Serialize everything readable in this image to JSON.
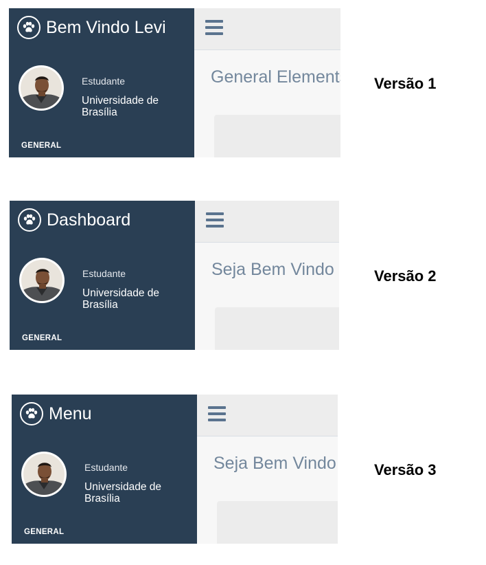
{
  "versions": [
    {
      "brand_title": "Bem Vindo Levi",
      "profile_role": "Estudante",
      "profile_institution": "Universidade de Brasília",
      "sidebar_section": "GENERAL",
      "page_title": "General Elements",
      "label": "Versão 1"
    },
    {
      "brand_title": "Dashboard",
      "profile_role": "Estudante",
      "profile_institution": "Universidade de Brasília",
      "sidebar_section": "GENERAL",
      "page_title": "Seja Bem Vindo",
      "label": "Versão 2"
    },
    {
      "brand_title": "Menu",
      "profile_role": "Estudante",
      "profile_institution": "Universidade de Brasília",
      "sidebar_section": "GENERAL",
      "page_title": "Seja Bem Vindo",
      "label": "Versão 3"
    }
  ],
  "icons": {
    "brand": "paw-icon",
    "toggle": "hamburger-icon",
    "avatar": "user-avatar"
  },
  "colors": {
    "sidebar": "#2a3f54",
    "topnav": "#ededed",
    "title": "#73879c",
    "toggle": "#5a738e"
  }
}
